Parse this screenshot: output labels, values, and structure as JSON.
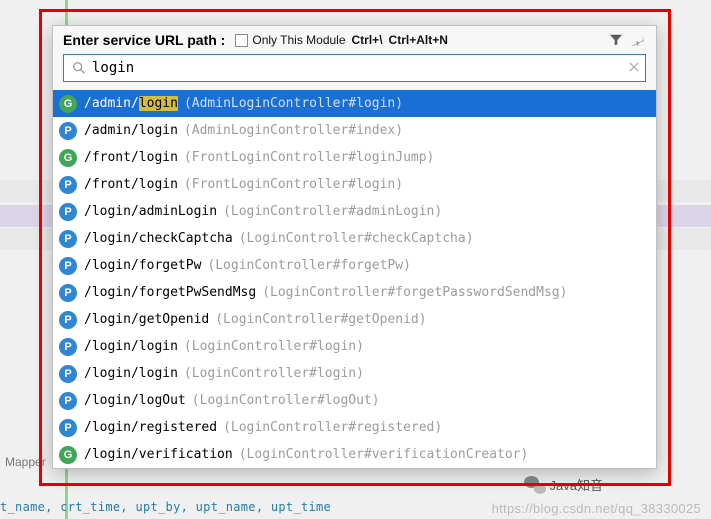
{
  "popup": {
    "title": "Enter service URL path :",
    "only_this_module_label": "Only This Module",
    "shortcut1": "Ctrl+\\",
    "shortcut2": "Ctrl+Alt+N",
    "filter_icon": "filter-icon",
    "pin_icon": "pin-icon",
    "search_value": "login",
    "search_placeholder": "",
    "results": [
      {
        "badge": "G",
        "path": "/admin/",
        "match": "login",
        "path_after": "",
        "meta": "(AdminLoginController#login)",
        "selected": true
      },
      {
        "badge": "P",
        "path": "/admin/login",
        "match": "",
        "path_after": "",
        "meta": "(AdminLoginController#index)",
        "selected": false
      },
      {
        "badge": "G",
        "path": "/front/login",
        "match": "",
        "path_after": "",
        "meta": "(FrontLoginController#loginJump)",
        "selected": false
      },
      {
        "badge": "P",
        "path": "/front/login",
        "match": "",
        "path_after": "",
        "meta": "(FrontLoginController#login)",
        "selected": false
      },
      {
        "badge": "P",
        "path": "/login/adminLogin",
        "match": "",
        "path_after": "",
        "meta": "(LoginController#adminLogin)",
        "selected": false
      },
      {
        "badge": "P",
        "path": "/login/checkCaptcha",
        "match": "",
        "path_after": "",
        "meta": "(LoginController#checkCaptcha)",
        "selected": false
      },
      {
        "badge": "P",
        "path": "/login/forgetPw",
        "match": "",
        "path_after": "",
        "meta": "(LoginController#forgetPw)",
        "selected": false
      },
      {
        "badge": "P",
        "path": "/login/forgetPwSendMsg",
        "match": "",
        "path_after": "",
        "meta": "(LoginController#forgetPasswordSendMsg)",
        "selected": false
      },
      {
        "badge": "P",
        "path": "/login/getOpenid",
        "match": "",
        "path_after": "",
        "meta": "(LoginController#getOpenid)",
        "selected": false
      },
      {
        "badge": "P",
        "path": "/login/login",
        "match": "",
        "path_after": "",
        "meta": "(LoginController#login)",
        "selected": false
      },
      {
        "badge": "P",
        "path": "/login/login",
        "match": "",
        "path_after": "",
        "meta": "(LoginController#login)",
        "selected": false
      },
      {
        "badge": "P",
        "path": "/login/logOut",
        "match": "",
        "path_after": "",
        "meta": "(LoginController#logOut)",
        "selected": false
      },
      {
        "badge": "P",
        "path": "/login/registered",
        "match": "",
        "path_after": "",
        "meta": "(LoginController#registered)",
        "selected": false
      },
      {
        "badge": "G",
        "path": "/login/verification",
        "match": "",
        "path_after": "",
        "meta": "(LoginController#verificationCreator)",
        "selected": false
      }
    ]
  },
  "background": {
    "mapper_label": "Mapper",
    "bottom_fields": "t_name, crt_time, upt_by, upt_name, upt_time",
    "wechat_label": "Java知音",
    "watermark": "https://blog.csdn.net/qq_38330025"
  }
}
